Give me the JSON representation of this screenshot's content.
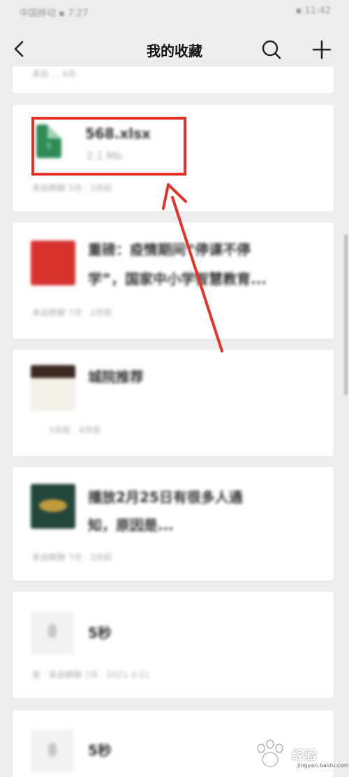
{
  "status_bar": {
    "left": "中国移动 ▪ 7:27",
    "right": "▪ 11:42"
  },
  "nav": {
    "title": "我的收藏"
  },
  "cards": [
    {
      "kind": "partial",
      "meta": "来自 ... 4月"
    },
    {
      "kind": "file",
      "title": "568.xlsx",
      "size": "2.1 Mb",
      "meta": "来自群聊 5月 · 3月前"
    },
    {
      "kind": "article",
      "title_line1": "重磅：疫情期间“停课不停",
      "title_line2": "学”，国家中小学智慧教育...",
      "meta": "来自群聊 7月 · 2月前"
    },
    {
      "kind": "article",
      "title_line1": "城院推荐",
      "meta": "· 3月前 · 4月前"
    },
    {
      "kind": "article",
      "title_line1": "播放2月25日有很多人通",
      "title_line2": "知，原因是...",
      "meta": "来自群聊 7月 · 3月前"
    },
    {
      "kind": "voice",
      "title": "5秒",
      "meta": "我 · 来自群聊 7月 · 2021-3-11"
    },
    {
      "kind": "voice",
      "title": "5秒"
    }
  ],
  "watermark": {
    "text": "经验",
    "sub": "jingyan.baidu.com"
  },
  "colors": {
    "annotation": "#e5332a",
    "file_icon": "#2e8b57"
  }
}
